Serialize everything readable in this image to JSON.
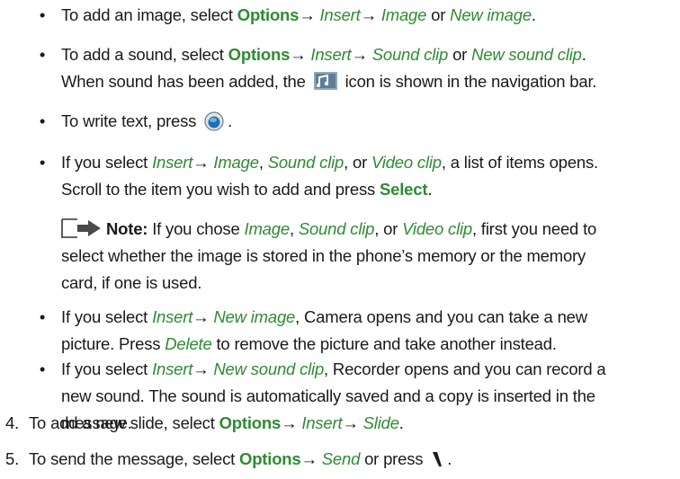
{
  "bullets": [
    {
      "p1": "To add an image, select ",
      "opt": "Options",
      "arrow1": "→ ",
      "link1": "Insert",
      "arrow2": "→ ",
      "link2": "Image",
      "p2": " or ",
      "link3": "New image",
      "p3": "."
    },
    {
      "p1": "To add a sound, select ",
      "opt": "Options",
      "arrow1": "→ ",
      "link1": "Insert",
      "arrow2": "→ ",
      "link2": "Sound clip",
      "p2": " or ",
      "link3": "New sound clip",
      "p3": ".",
      "line2a": "When sound has been added, the ",
      "line2b": " icon is shown in the navigation bar."
    },
    {
      "p1": "To write text, press ",
      "p2": "."
    },
    {
      "p1": "If you select ",
      "link1": "Insert",
      "arrow1": "→ ",
      "link2": "Image",
      "p2": ", ",
      "link3": "Sound clip",
      "p3": ", or ",
      "link4": "Video clip",
      "p4": ", a list of items opens.",
      "line2a": "Scroll to the item you wish to add and press ",
      "opt": "Select",
      "line2b": "."
    },
    {
      "p1": "If you select ",
      "link1": "Insert",
      "arrow1": "→ ",
      "link2": "New image",
      "p2": ", Camera opens and you can take a new",
      "line2a": "picture. Press ",
      "link3": "Delete",
      "line2b": " to remove the picture and take another instead."
    },
    {
      "p1": "If you select ",
      "link1": "Insert",
      "arrow1": "→ ",
      "link2": "New sound clip",
      "p2": ", Recorder opens and you can record a",
      "line2": "new sound. The sound is automatically saved and a copy is inserted in the",
      "line3": "message."
    }
  ],
  "note": {
    "label": "Note:",
    "p1": " If you chose ",
    "link1": "Image",
    "p2": ", ",
    "link2": "Sound clip",
    "p3": ", or ",
    "link3": "Video clip",
    "p4": ", first you need to",
    "line2": "select whether the image is stored in the phone’s memory or the memory",
    "line3": "card, if one is used."
  },
  "steps": [
    {
      "number": "4.",
      "p1": "To add a new slide, select ",
      "opt": "Options",
      "arrow1": "→ ",
      "link1": "Insert",
      "arrow2": "→ ",
      "link2": "Slide",
      "p2": "."
    },
    {
      "number": "5.",
      "p1": "To send the message, select ",
      "opt": "Options",
      "arrow1": "→ ",
      "link1": "Send",
      "p2": " or press ",
      "p3": "."
    }
  ],
  "bullet_glyph": "•",
  "colors": {
    "link": "#2e8b32",
    "text": "#1a1a1a"
  },
  "icons": {
    "sound": "sound-clip-icon",
    "joystick": "navigation-key-icon",
    "send": "call-send-key-icon",
    "note": "note-arrow-icon"
  }
}
